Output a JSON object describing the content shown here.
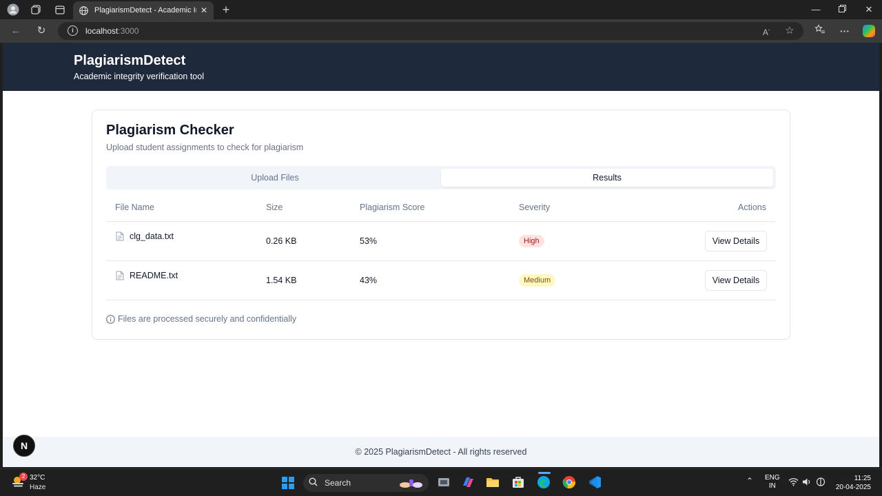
{
  "browser": {
    "tab_title": "PlagiarismDetect - Academic Integrity Verification Tool",
    "url_host": "localhost",
    "url_port": ":3000"
  },
  "app": {
    "brand_title": "PlagiarismDetect",
    "brand_subtitle": "Academic integrity verification tool"
  },
  "card": {
    "title": "Plagiarism Checker",
    "description": "Upload student assignments to check for plagiarism",
    "tabs": [
      {
        "label": "Upload Files",
        "active": false
      },
      {
        "label": "Results",
        "active": true
      }
    ],
    "table": {
      "headers": {
        "file_name": "File Name",
        "size": "Size",
        "score": "Plagiarism Score",
        "severity": "Severity",
        "actions": "Actions"
      },
      "rows": [
        {
          "file_name": "clg_data.txt",
          "size": "0.26 KB",
          "score": "53%",
          "severity": "High",
          "action": "View Details"
        },
        {
          "file_name": "README.txt",
          "size": "1.54 KB",
          "score": "43%",
          "severity": "Medium",
          "action": "View Details"
        }
      ]
    },
    "note": "Files are processed securely and confidentially"
  },
  "footer": {
    "text": "© 2025 PlagiarismDetect - All rights reserved"
  },
  "taskbar": {
    "weather_temp": "32°C",
    "weather_desc": "Haze",
    "weather_badge": "2",
    "search_label": "Search",
    "lang_line1": "ENG",
    "lang_line2": "IN",
    "time": "11:25",
    "date": "20-04-2025"
  },
  "colors": {
    "header_bg": "#1e293b",
    "high_badge_bg": "#fee2e2",
    "medium_badge_bg": "#fef9c3"
  }
}
